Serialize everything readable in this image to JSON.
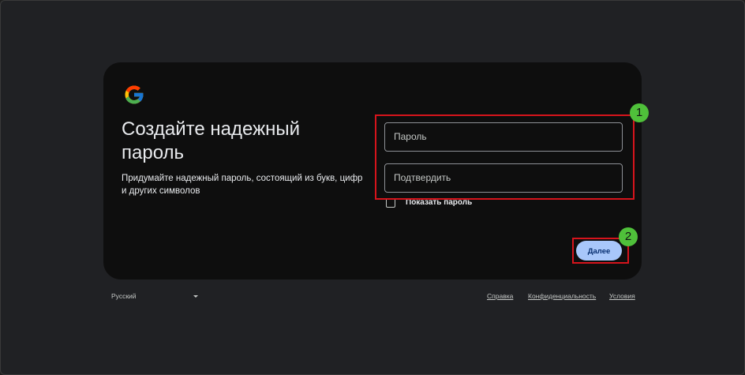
{
  "card": {
    "title": "Создайте надежный пароль",
    "subtitle": "Придумайте надежный пароль, состоящий из букв, цифр и других символов"
  },
  "form": {
    "password_placeholder": "Пароль",
    "confirm_placeholder": "Подтвердить",
    "show_password_label": "Показать пароль",
    "next_label": "Далее"
  },
  "annotations": {
    "badge_1": "1",
    "badge_2": "2",
    "highlight_color": "#d6141c",
    "badge_color": "#4fc03a"
  },
  "footer": {
    "language": "Русский",
    "help": "Справка",
    "privacy": "Конфиденциальность",
    "terms": "Условия"
  },
  "icons": {
    "logo": "google-g-icon",
    "checkbox": "checkbox-icon",
    "dropdown": "caret-down-icon"
  },
  "colors": {
    "card_bg": "#0e0e0e",
    "page_bg": "#202124",
    "button_bg": "#a8c7fa"
  }
}
